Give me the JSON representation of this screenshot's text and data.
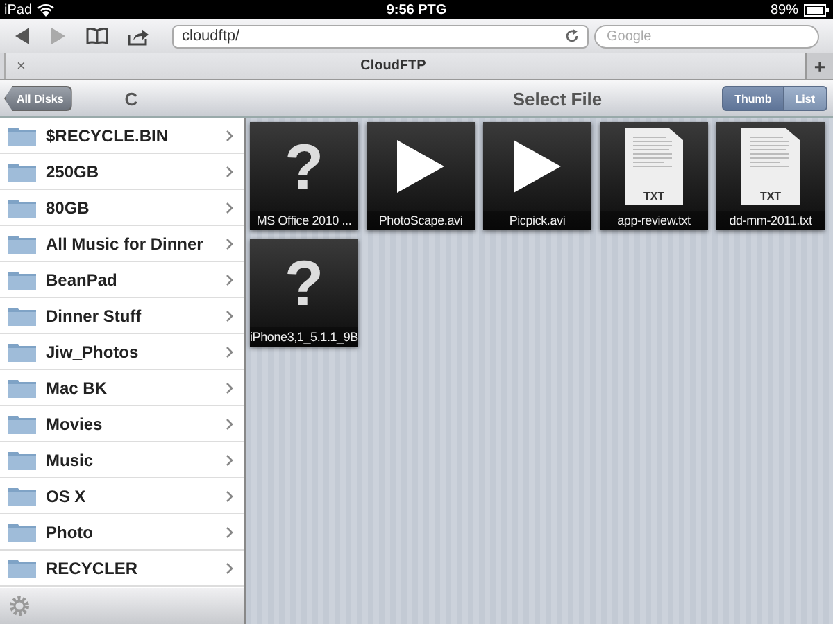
{
  "status_bar": {
    "device": "iPad",
    "time": "9:56 PTG",
    "battery": "89%"
  },
  "browser": {
    "url": "cloudftp/",
    "search": {
      "placeholder": "Google"
    },
    "tab": {
      "close": "×",
      "title": "CloudFTP"
    },
    "new_tab": "+"
  },
  "nav": {
    "back": "All Disks",
    "folder": "C",
    "title": "Select File",
    "view": [
      {
        "label": "Thumb",
        "selected": true
      },
      {
        "label": "List",
        "selected": false
      }
    ]
  },
  "sidebar": {
    "items": [
      {
        "label": "$RECYCLE.BIN"
      },
      {
        "label": "250GB"
      },
      {
        "label": "80GB"
      },
      {
        "label": "All Music for Dinner"
      },
      {
        "label": "BeanPad"
      },
      {
        "label": "Dinner Stuff"
      },
      {
        "label": "Jiw_Photos"
      },
      {
        "label": "Mac BK"
      },
      {
        "label": "Movies"
      },
      {
        "label": "Music"
      },
      {
        "label": "OS X"
      },
      {
        "label": "Photo"
      },
      {
        "label": "RECYCLER"
      }
    ]
  },
  "files": [
    {
      "name": "MS Office 2010 ...",
      "kind": "unknown",
      "glyph": "?"
    },
    {
      "name": "PhotoScape.avi",
      "kind": "video"
    },
    {
      "name": "Picpick.avi",
      "kind": "video"
    },
    {
      "name": "app-review.txt",
      "kind": "text",
      "badge": "TXT"
    },
    {
      "name": "dd-mm-2011.txt",
      "kind": "text",
      "badge": "TXT"
    },
    {
      "name": "iPhone3,1_5.1.1_9B",
      "kind": "unknown",
      "glyph": "?"
    }
  ]
}
